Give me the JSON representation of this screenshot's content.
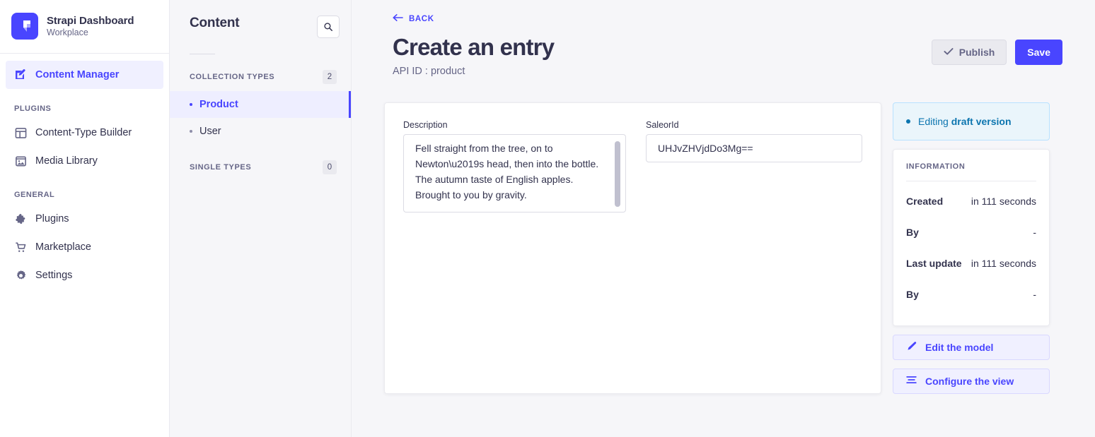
{
  "brand": {
    "title": "Strapi Dashboard",
    "subtitle": "Workplace",
    "logo_icon": "strapi-logo-icon",
    "logo_color": "#4945ff"
  },
  "sidebar": {
    "primary": [
      {
        "label": "Content Manager",
        "icon": "pencil-square-icon",
        "active": true
      }
    ],
    "sections": [
      {
        "label": "PLUGINS",
        "items": [
          {
            "label": "Content-Type Builder",
            "icon": "layout-grid-icon"
          },
          {
            "label": "Media Library",
            "icon": "image-icon"
          }
        ]
      },
      {
        "label": "GENERAL",
        "items": [
          {
            "label": "Plugins",
            "icon": "puzzle-piece-icon"
          },
          {
            "label": "Marketplace",
            "icon": "shopping-cart-icon"
          },
          {
            "label": "Settings",
            "icon": "gear-icon"
          }
        ]
      }
    ]
  },
  "content_panel": {
    "title": "Content",
    "search_icon": "search-icon",
    "groups": [
      {
        "label": "COLLECTION TYPES",
        "count": "2",
        "items": [
          {
            "label": "Product",
            "active": true
          },
          {
            "label": "User",
            "active": false
          }
        ]
      },
      {
        "label": "SINGLE TYPES",
        "count": "0",
        "items": []
      }
    ]
  },
  "main": {
    "back_label": "BACK",
    "back_icon": "arrow-left-icon",
    "page_title": "Create an entry",
    "page_subtitle": "API ID : product",
    "publish_label": "Publish",
    "publish_icon": "check-icon",
    "save_label": "Save"
  },
  "form": {
    "description": {
      "label": "Description",
      "value": "Fell straight from the tree, on to Newton\\u2019s head, then into the bottle. The autumn taste of English apples. Brought to you by gravity."
    },
    "saleor_id": {
      "label": "SaleorId",
      "value": "UHJvZHVjdDo3Mg=="
    }
  },
  "side_panel": {
    "draft_prefix": "Editing ",
    "draft_strong": "draft version",
    "draft_color": "#0c75af",
    "information_title": "INFORMATION",
    "rows": [
      {
        "key": "Created",
        "value": "in 111 seconds"
      },
      {
        "key": "By",
        "value": "-"
      },
      {
        "key": "Last update",
        "value": "in 111 seconds"
      },
      {
        "key": "By",
        "value": "-"
      }
    ],
    "edit_model_label": "Edit the model",
    "edit_model_icon": "pencil-icon",
    "configure_view_label": "Configure the view",
    "configure_view_icon": "sliders-icon"
  }
}
